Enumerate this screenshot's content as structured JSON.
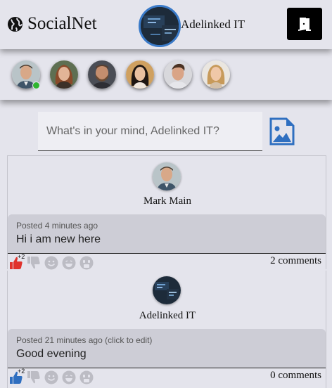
{
  "header": {
    "brand": "SocialNet",
    "brand_icon": "globe-icon",
    "user_name": "Adelinked IT",
    "logout_icon": "door-exit-icon"
  },
  "friends": [
    {
      "name": "friend-1",
      "online": true
    },
    {
      "name": "friend-2",
      "online": false
    },
    {
      "name": "friend-3",
      "online": false
    },
    {
      "name": "friend-4",
      "online": false
    },
    {
      "name": "friend-5",
      "online": false
    },
    {
      "name": "friend-6",
      "online": false
    }
  ],
  "composer": {
    "placeholder": "What's in your mind, Adelinked IT?",
    "value": "",
    "image_icon": "image-upload-icon"
  },
  "posts": [
    {
      "author": "Mark Main",
      "meta": "Posted 4 minutes ago",
      "text": "Hi i am new here",
      "like_count": "+2",
      "like_color": "#e0322c",
      "comments": "2 comments"
    },
    {
      "author": "Adelinked IT",
      "meta": "Posted 21 minutes ago (click to edit)",
      "text": "Good evening",
      "like_count": "+2",
      "like_color": "#2f6fc0",
      "comments": "0 comments"
    }
  ],
  "reaction_icons": [
    "thumbs-up-icon",
    "thumbs-down-icon",
    "smile-icon",
    "laugh-icon",
    "surprised-icon"
  ],
  "colors": {
    "background": "#e4e4ec",
    "accent": "#2f6fc0",
    "online": "#2fb52f"
  }
}
